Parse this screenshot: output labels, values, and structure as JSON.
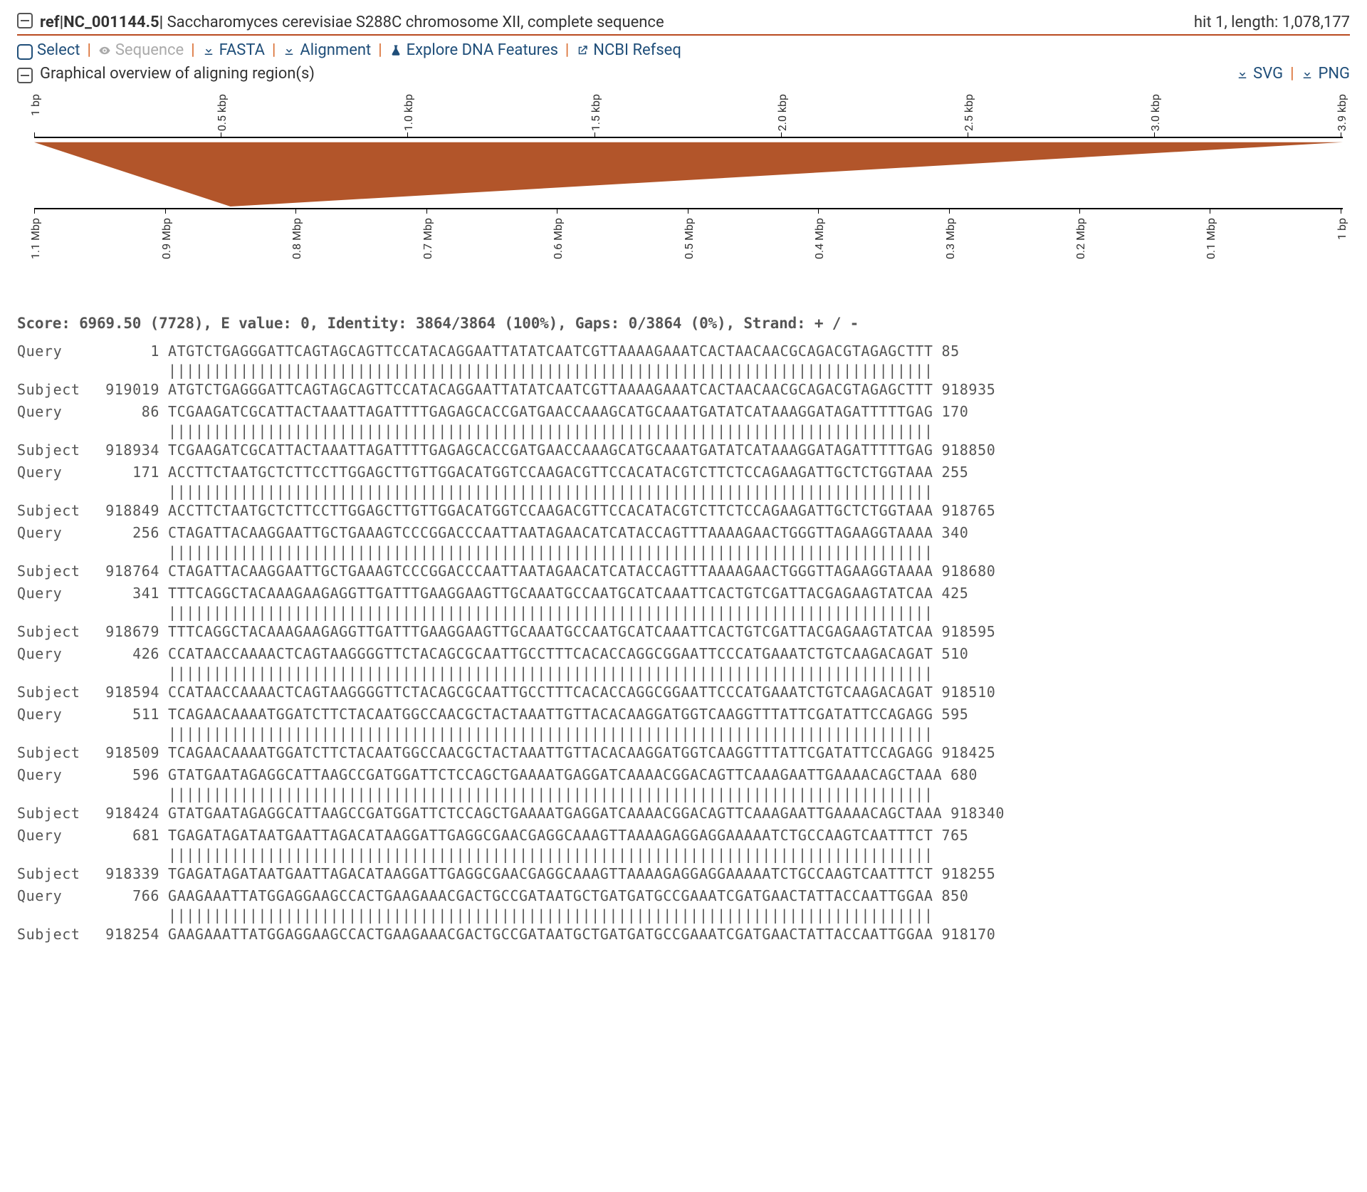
{
  "header": {
    "collapse_icon": "minus-box",
    "ref_id": "ref|NC_001144.5|",
    "ref_desc": "Saccharomyces cerevisiae S288C chromosome XII, complete sequence",
    "hit_info": "hit 1, length: 1,078,177"
  },
  "toolbar": {
    "select": "Select",
    "sequence": "Sequence",
    "fasta": "FASTA",
    "alignment": "Alignment",
    "explore": "Explore DNA Features",
    "ncbi": "NCBI Refseq"
  },
  "graph": {
    "title": "Graphical overview of aligning region(s)",
    "svg": "SVG",
    "png": "PNG",
    "top_ticks": [
      "1 bp",
      "0.5 kbp",
      "1.0 kbp",
      "1.5 kbp",
      "2.0 kbp",
      "2.5 kbp",
      "3.0 kbp",
      "3.9 kbp"
    ],
    "bottom_ticks": [
      "1.1 Mbp",
      "0.9 Mbp",
      "0.8 Mbp",
      "0.7 Mbp",
      "0.6 Mbp",
      "0.5 Mbp",
      "0.4 Mbp",
      "0.3 Mbp",
      "0.2 Mbp",
      "0.1 Mbp",
      "1 bp"
    ]
  },
  "stats": "Score: 6969.50 (7728), E value: 0, Identity: 3864/3864 (100%), Gaps: 0/3864 (0%), Strand: + / -",
  "alignment": {
    "match_bar": "|||||||||||||||||||||||||||||||||||||||||||||||||||||||||||||||||||||||||||||||||||||",
    "blocks": [
      {
        "q_label": "Query",
        "q_start": "1",
        "q_seq": "ATGTCTGAGGGATTCAGTAGCAGTTCCATACAGGAATTATATCAATCGTTAAAAGAAATCACTAACAACGCAGACGTAGAGCTTT",
        "q_end": "85",
        "s_label": "Subject",
        "s_start": "919019",
        "s_seq": "ATGTCTGAGGGATTCAGTAGCAGTTCCATACAGGAATTATATCAATCGTTAAAAGAAATCACTAACAACGCAGACGTAGAGCTTT",
        "s_end": "918935"
      },
      {
        "q_label": "Query",
        "q_start": "86",
        "q_seq": "TCGAAGATCGCATTACTAAATTAGATTTTGAGAGCACCGATGAACCAAAGCATGCAAATGATATCATAAAGGATAGATTTTTGAG",
        "q_end": "170",
        "s_label": "Subject",
        "s_start": "918934",
        "s_seq": "TCGAAGATCGCATTACTAAATTAGATTTTGAGAGCACCGATGAACCAAAGCATGCAAATGATATCATAAAGGATAGATTTTTGAG",
        "s_end": "918850"
      },
      {
        "q_label": "Query",
        "q_start": "171",
        "q_seq": "ACCTTCTAATGCTCTTCCTTGGAGCTTGTTGGACATGGTCCAAGACGTTCCACATACGTCTTCTCCAGAAGATTGCTCTGGTAAA",
        "q_end": "255",
        "s_label": "Subject",
        "s_start": "918849",
        "s_seq": "ACCTTCTAATGCTCTTCCTTGGAGCTTGTTGGACATGGTCCAAGACGTTCCACATACGTCTTCTCCAGAAGATTGCTCTGGTAAA",
        "s_end": "918765"
      },
      {
        "q_label": "Query",
        "q_start": "256",
        "q_seq": "CTAGATTACAAGGAATTGCTGAAAGTCCCGGACCCAATTAATAGAACATCATACCAGTTTAAAAGAACTGGGTTAGAAGGTAAAA",
        "q_end": "340",
        "s_label": "Subject",
        "s_start": "918764",
        "s_seq": "CTAGATTACAAGGAATTGCTGAAAGTCCCGGACCCAATTAATAGAACATCATACCAGTTTAAAAGAACTGGGTTAGAAGGTAAAA",
        "s_end": "918680"
      },
      {
        "q_label": "Query",
        "q_start": "341",
        "q_seq": "TTTCAGGCTACAAAGAAGAGGTTGATTTGAAGGAAGTTGCAAATGCCAATGCATCAAATTCACTGTCGATTACGAGAAGTATCAA",
        "q_end": "425",
        "s_label": "Subject",
        "s_start": "918679",
        "s_seq": "TTTCAGGCTACAAAGAAGAGGTTGATTTGAAGGAAGTTGCAAATGCCAATGCATCAAATTCACTGTCGATTACGAGAAGTATCAA",
        "s_end": "918595"
      },
      {
        "q_label": "Query",
        "q_start": "426",
        "q_seq": "CCATAACCAAAACTCAGTAAGGGGTTCTACAGCGCAATTGCCTTTCACACCAGGCGGAATTCCCATGAAATCTGTCAAGACAGAT",
        "q_end": "510",
        "s_label": "Subject",
        "s_start": "918594",
        "s_seq": "CCATAACCAAAACTCAGTAAGGGGTTCTACAGCGCAATTGCCTTTCACACCAGGCGGAATTCCCATGAAATCTGTCAAGACAGAT",
        "s_end": "918510"
      },
      {
        "q_label": "Query",
        "q_start": "511",
        "q_seq": "TCAGAACAAAATGGATCTTCTACAATGGCCAACGCTACTAAATTGTTACACAAGGATGGTCAAGGTTTATTCGATATTCCAGAGG",
        "q_end": "595",
        "s_label": "Subject",
        "s_start": "918509",
        "s_seq": "TCAGAACAAAATGGATCTTCTACAATGGCCAACGCTACTAAATTGTTACACAAGGATGGTCAAGGTTTATTCGATATTCCAGAGG",
        "s_end": "918425"
      },
      {
        "q_label": "Query",
        "q_start": "596",
        "q_seq": "GTATGAATAGAGGCATTAAGCCGATGGATTCTCCAGCTGAAAATGAGGATCAAAACGGACAGTTCAAAGAATTGAAAACAGCTAAA",
        "q_end": "680",
        "s_label": "Subject",
        "s_start": "918424",
        "s_seq": "GTATGAATAGAGGCATTAAGCCGATGGATTCTCCAGCTGAAAATGAGGATCAAAACGGACAGTTCAAAGAATTGAAAACAGCTAAA",
        "s_end": "918340"
      },
      {
        "q_label": "Query",
        "q_start": "681",
        "q_seq": "TGAGATAGATAATGAATTAGACATAAGGATTGAGGCGAACGAGGCAAAGTTAAAAGAGGAGGAAAAATCTGCCAAGTCAATTTCT",
        "q_end": "765",
        "s_label": "Subject",
        "s_start": "918339",
        "s_seq": "TGAGATAGATAATGAATTAGACATAAGGATTGAGGCGAACGAGGCAAAGTTAAAAGAGGAGGAAAAATCTGCCAAGTCAATTTCT",
        "s_end": "918255"
      },
      {
        "q_label": "Query",
        "q_start": "766",
        "q_seq": "GAAGAAATTATGGAGGAAGCCACTGAAGAAACGACTGCCGATAATGCTGATGATGCCGAAATCGATGAACTATTACCAATTGGAA",
        "q_end": "850",
        "s_label": "Subject",
        "s_start": "918254",
        "s_seq": "GAAGAAATTATGGAGGAAGCCACTGAAGAAACGACTGCCGATAATGCTGATGATGCCGAAATCGATGAACTATTACCAATTGGAA",
        "s_end": "918170"
      }
    ]
  }
}
